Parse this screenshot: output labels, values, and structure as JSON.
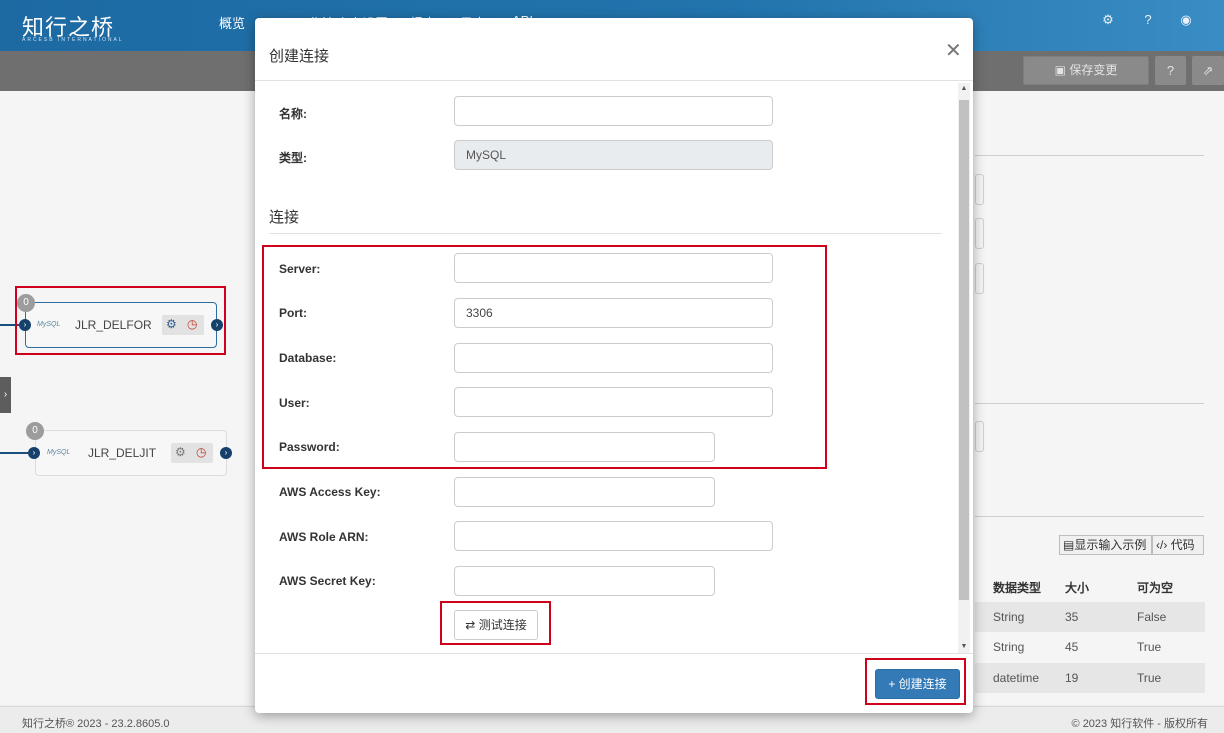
{
  "app": {
    "logo": "知行之桥",
    "logo_sub": "ARCESB INTERNATIONAL",
    "nav": [
      "概览",
      "工作流",
      "个人设置",
      "报表",
      "日志",
      "API"
    ],
    "save_changes": "保存变更"
  },
  "canvas": {
    "nodes": [
      {
        "name": "JLR_DELFOR",
        "badge": "0",
        "logo": "MySQL"
      },
      {
        "name": "JLR_DELJIT",
        "badge": "0",
        "logo": "MySQL"
      }
    ]
  },
  "right_panel": {
    "show_sample": "显示输入示例",
    "code": "代码",
    "columns": [
      "数据类型",
      "大小",
      "可为空"
    ],
    "rows": [
      {
        "type": "String",
        "size": "35",
        "nullable": "False"
      },
      {
        "type": "String",
        "size": "45",
        "nullable": "True"
      },
      {
        "type": "datetime",
        "size": "19",
        "nullable": "True"
      }
    ]
  },
  "footer": {
    "left": "知行之桥® 2023 - 23.2.8605.0",
    "right": "© 2023 知行软件 - 版权所有"
  },
  "modal": {
    "title": "创建连接",
    "fields": {
      "name": {
        "label": "名称:",
        "value": ""
      },
      "type": {
        "label": "类型:",
        "value": "MySQL"
      }
    },
    "section_title": "连接",
    "connection": {
      "server": {
        "label": "Server:",
        "value": ""
      },
      "port": {
        "label": "Port:",
        "value": "3306"
      },
      "database": {
        "label": "Database:",
        "value": ""
      },
      "user": {
        "label": "User:",
        "value": ""
      },
      "password": {
        "label": "Password:",
        "value": ""
      }
    },
    "aws": {
      "access_key": {
        "label": "AWS Access Key:",
        "value": ""
      },
      "role_arn": {
        "label": "AWS Role ARN:",
        "value": ""
      },
      "secret_key": {
        "label": "AWS Secret Key:",
        "value": ""
      }
    },
    "test_button": "测试连接",
    "create_button": "创建连接"
  }
}
